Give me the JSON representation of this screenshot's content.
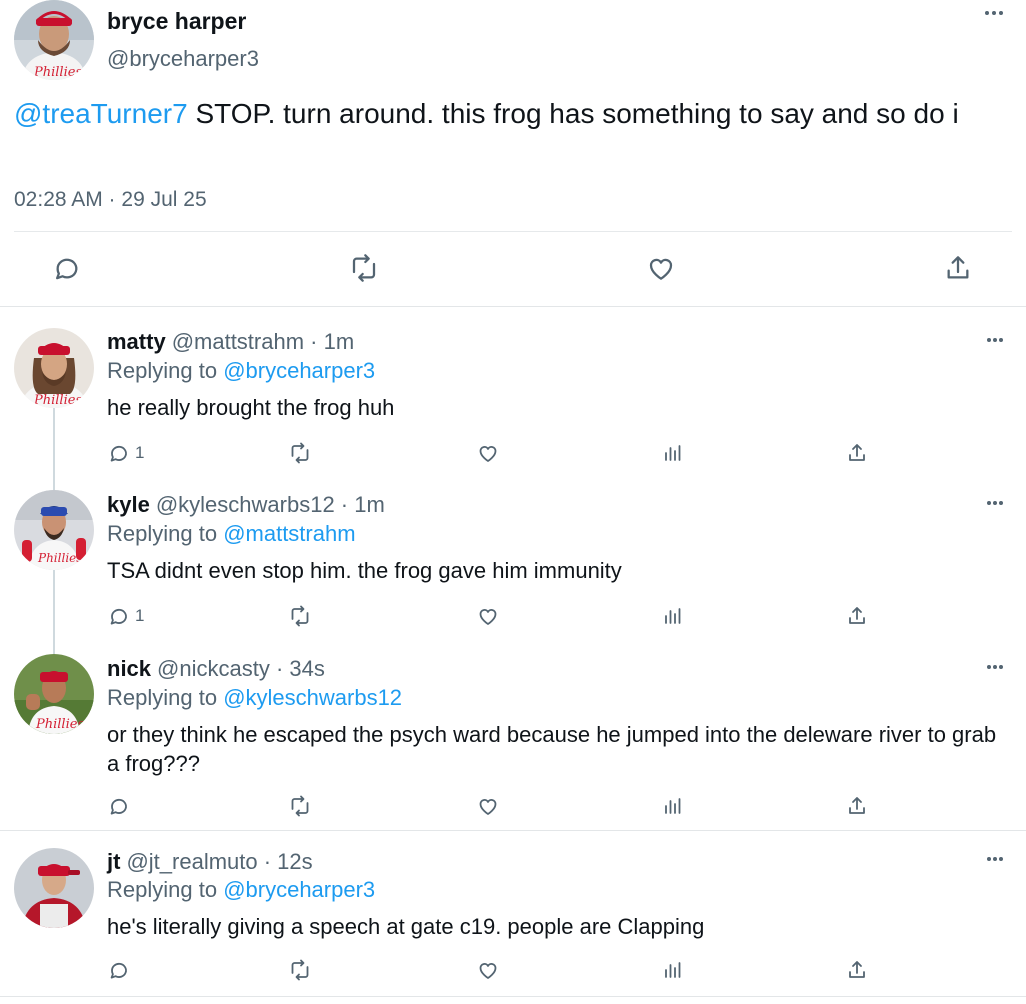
{
  "main_tweet": {
    "author_name": "bryce harper",
    "author_handle": "@bryceharper3",
    "mention": "@treaTurner7",
    "text": " STOP. turn around. this frog has something to say and so do i",
    "timestamp": "02:28 AM · 29 Jul 25",
    "actions": [
      "reply-icon",
      "retweet-icon",
      "like-icon",
      "share-icon"
    ]
  },
  "replies": [
    {
      "name": "matty",
      "handle": "@mattstrahm · 1m",
      "replying_prefix": "Replying to ",
      "replying_to": "@bryceharper3",
      "text": "he really brought the frog huh",
      "reply_count": "1"
    },
    {
      "name": "kyle",
      "handle": "@kyleschwarbs12 · 1m",
      "replying_prefix": "Replying to ",
      "replying_to": "@mattstrahm",
      "text": "TSA didnt even stop him. the frog gave him immunity",
      "reply_count": "1"
    },
    {
      "name": "nick",
      "handle": "@nickcasty · 34s",
      "replying_prefix": "Replying to ",
      "replying_to": "@kyleschwarbs12",
      "text": "or they think he escaped the psych ward because he jumped into the deleware river to grab a frog???",
      "reply_count": ""
    },
    {
      "name": "jt",
      "handle": "@jt_realmuto · 12s",
      "replying_prefix": "Replying to ",
      "replying_to": "@bryceharper3",
      "text": "he's literally giving a speech at gate c19. people are Clapping",
      "reply_count": ""
    }
  ],
  "colors": {
    "accent": "#1d9bf0",
    "text": "#0f1419",
    "secondary": "#536471",
    "phillies_red": "#d41f33"
  }
}
